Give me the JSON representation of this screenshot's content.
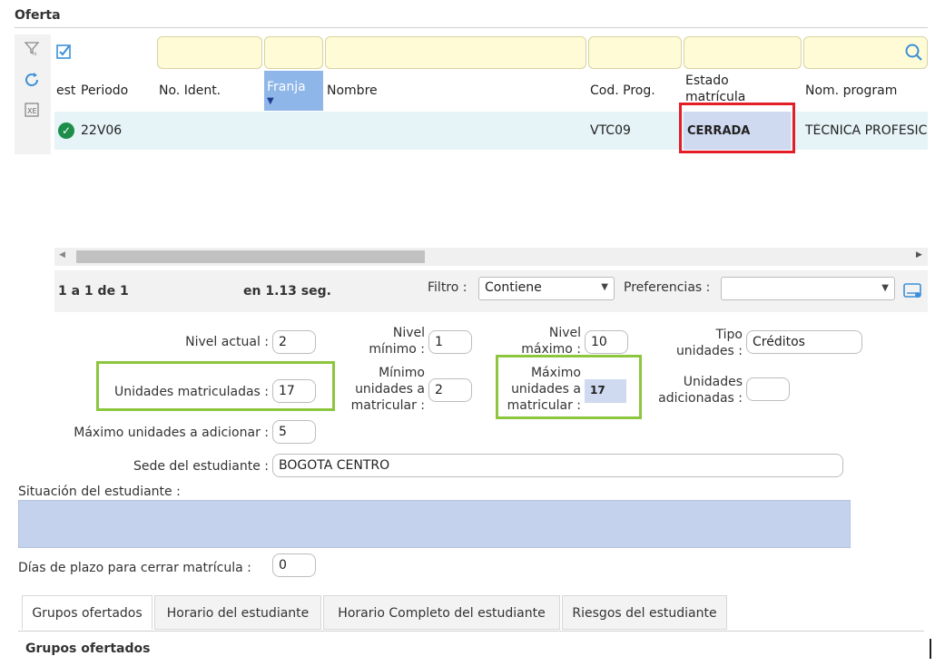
{
  "page": {
    "title": "Oferta"
  },
  "grid": {
    "headers": {
      "est": "est",
      "periodo": "Periodo",
      "no_ident": "No. Ident.",
      "franja": "Franja",
      "nombre": "Nombre",
      "cod_prog": "Cod. Prog.",
      "estado_matricula": "Estado matrícula",
      "nom_programa": "Nom. program"
    },
    "row": {
      "periodo": "22V06",
      "cod_prog": "VTC09",
      "estado_matricula": "CERRADA",
      "nom_programa": "TÉCNICA PROFESIC"
    },
    "pagination": "1 a 1 de 1",
    "timing": "en 1.13 seg.",
    "filter_label": "Filtro :",
    "filter_value": "Contiene",
    "preferences_label": "Preferencias :",
    "preferences_value": ""
  },
  "form": {
    "nivel_actual": {
      "label": "Nivel actual :",
      "value": "2"
    },
    "nivel_minimo": {
      "label1": "Nivel",
      "label2": "mínimo :",
      "value": "1"
    },
    "nivel_maximo": {
      "label1": "Nivel",
      "label2": "máximo :",
      "value": "10"
    },
    "tipo_unidades": {
      "label1": "Tipo",
      "label2": "unidades :",
      "value": "Créditos"
    },
    "unidades_matriculadas": {
      "label": "Unidades matriculadas :",
      "value": "17"
    },
    "minimo_unidades": {
      "label1": "Mínimo",
      "label2": "unidades a",
      "label3": "matricular :",
      "value": "2"
    },
    "maximo_unidades": {
      "label1": "Máximo",
      "label2": "unidades a",
      "label3": "matricular :",
      "value": "17"
    },
    "unidades_adicionales": {
      "label1": "Unidades",
      "label2": "adicionadas :",
      "value": ""
    },
    "maximo_adicionar": {
      "label": "Máximo unidades a adicionar :",
      "value": "5"
    },
    "sede": {
      "label": "Sede del estudiante :",
      "value": "BOGOTA CENTRO"
    },
    "situacion": {
      "label": "Situación del estudiante :",
      "value": ""
    },
    "dias_plazo": {
      "label": "Días de plazo para cerrar matrícula :",
      "value": "0"
    }
  },
  "tabs": [
    {
      "label": "Grupos ofertados"
    },
    {
      "label": "Horario del estudiante"
    },
    {
      "label": "Horario Completo del estudiante"
    },
    {
      "label": "Riesgos del estudiante"
    }
  ],
  "section_title": "Grupos ofertados",
  "icons": [
    "filter-clear-icon",
    "refresh-icon",
    "excel-export-icon",
    "select-all-check-icon",
    "search-icon",
    "check-circle-icon",
    "export-icon",
    "dropdown-arrow-icon"
  ],
  "colors": {
    "highlight_green": "#8cc63f",
    "highlight_red": "#e41e26",
    "filter_yellow": "#fffbd6",
    "selected_blue": "#cfd9ef"
  }
}
